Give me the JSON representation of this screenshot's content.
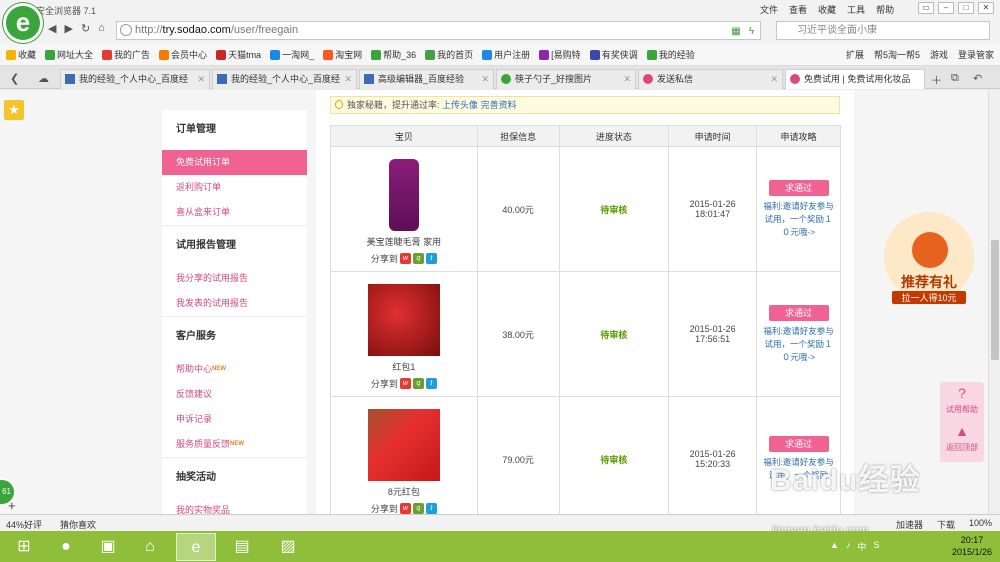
{
  "window": {
    "title": "360安全浏览器 7.1",
    "menus": [
      "文件",
      "查看",
      "收藏",
      "工具",
      "帮助"
    ]
  },
  "address": {
    "url_prefix": "http://",
    "url_host": "try.sodao.com",
    "url_path": "/user/freegain",
    "search_placeholder": "习近平谈全面小康"
  },
  "bookmarks": {
    "items": [
      {
        "label": "收藏",
        "color": "#f4b400"
      },
      {
        "label": "网址大全",
        "color": "#3aa53a"
      },
      {
        "label": "我的广告",
        "color": "#e53935"
      },
      {
        "label": "会员中心",
        "color": "#f57c00"
      },
      {
        "label": "天猫tma",
        "color": "#c62828"
      },
      {
        "label": "一淘网_",
        "color": "#1e88e5"
      },
      {
        "label": "淘宝网",
        "color": "#ff5722"
      },
      {
        "label": "帮助_36",
        "color": "#3aa53a"
      },
      {
        "label": "我的首页",
        "color": "#43a047"
      },
      {
        "label": "用户注册",
        "color": "#1e88e5"
      },
      {
        "label": "[易购特",
        "color": "#8e24aa"
      },
      {
        "label": "有奖侠调",
        "color": "#3949ab"
      },
      {
        "label": "我的经验",
        "color": "#3aa53a"
      }
    ],
    "right": [
      "扩展",
      "帮5淘一帮5",
      "游戏",
      "登录管家"
    ]
  },
  "tabs": [
    {
      "label": "我的经验_个人中心_百度经",
      "active": false
    },
    {
      "label": "我的经验_个人中心_百度经",
      "active": false
    },
    {
      "label": "高级编辑器_百度经验",
      "active": false
    },
    {
      "label": "筷子勺子_好搜图片",
      "active": false
    },
    {
      "label": "发送私信",
      "active": false
    },
    {
      "label": "免费试用 | 免费试用化妆品",
      "active": true
    }
  ],
  "sidebar": {
    "groups": [
      {
        "heading": "订单管理",
        "items": [
          "免费试用订单",
          "返利购订单",
          "喜从盒来订单"
        ]
      },
      {
        "heading": "试用报告管理",
        "items": [
          "我分享的试用报告",
          "我发表的试用报告"
        ]
      },
      {
        "heading": "客户服务",
        "items": [
          "帮助中心",
          "反馈建议",
          "申诉记录",
          "服务质量反馈"
        ]
      },
      {
        "heading": "抽奖活动",
        "items": [
          "我的实物奖品"
        ]
      }
    ],
    "new_badge": "NEW"
  },
  "tip": {
    "text": "独家秘籍，提升通过率:",
    "link1": "上传头像",
    "link2": "完善资料"
  },
  "table": {
    "headers": [
      "宝贝",
      "担保信息",
      "进度状态",
      "申请时间",
      "申请攻略"
    ],
    "share_label": "分享到",
    "rows": [
      {
        "product": "美宝莲睫毛膏 家用",
        "guarantee": "40.00元",
        "status": "待审核",
        "date": "2015-01-26",
        "time": "18:01:47",
        "button": "求通过",
        "guide": "福利:邀请好友参与试用，一个奖励１０元哦->"
      },
      {
        "product": "红包1",
        "guarantee": "38.00元",
        "status": "待审核",
        "date": "2015-01-26",
        "time": "17:56:51",
        "button": "求通过",
        "guide": "福利:邀请好友参与试用，一个奖励１０元哦->"
      },
      {
        "product": "8元红包",
        "guarantee": "79.00元",
        "status": "待审核",
        "date": "2015-01-26",
        "time": "15:20:33",
        "button": "求通过",
        "guide": "福利:邀请好友参与试用，一个奖励"
      }
    ]
  },
  "promo": {
    "line1": "推荐有礼",
    "line2": "拉一人得10元"
  },
  "float_buttons": [
    "试用帮助",
    "返回顶部"
  ],
  "left_badge": "61",
  "statusbar": {
    "left": [
      "44%好评",
      "猜你喜欢"
    ],
    "right": [
      "加速器",
      "下载",
      "100%"
    ]
  },
  "watermark": {
    "brand": "Baidu经验",
    "url": "jingyan.baidu.com"
  },
  "clock": {
    "time": "20:17",
    "date": "2015/1/26"
  },
  "tray": [
    "中",
    "S"
  ]
}
